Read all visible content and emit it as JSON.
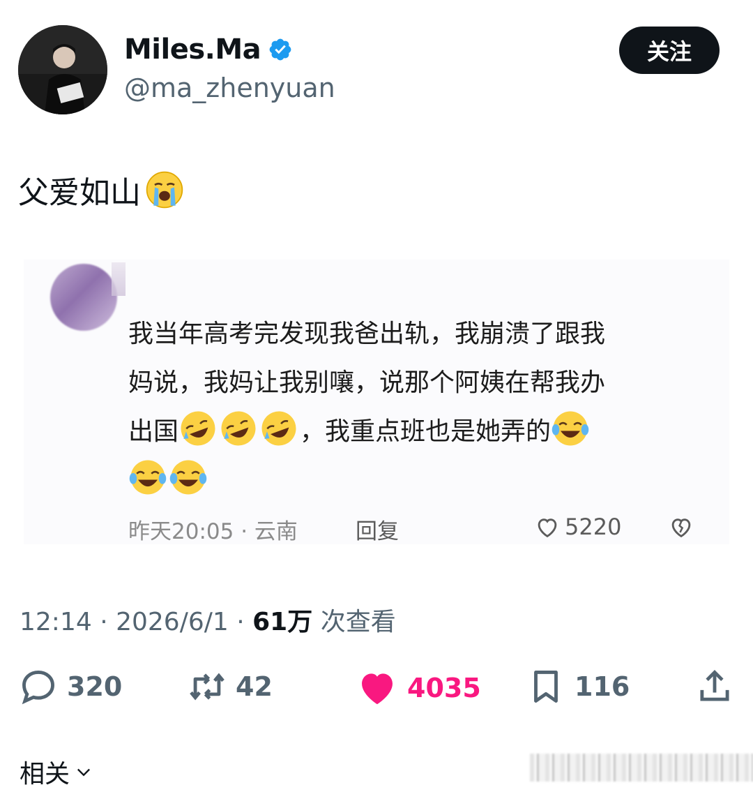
{
  "header": {
    "display_name": "Miles.Ma",
    "handle": "@ma_zhenyuan",
    "follow_label": "关注"
  },
  "tweet": {
    "text": "父爱如山",
    "emoji": "loudly-crying-face"
  },
  "embedded_comment": {
    "line1": "我当年高考完发现我爸出轨，我崩溃了跟我",
    "line2": "妈说，我妈让我别嚷，说那个阿姨在帮我办",
    "line3_prefix": "出国",
    "line3_middle": "，我重点班也是她弄的",
    "meta": "昨天20:05 · 云南",
    "reply_label": "回复",
    "likes": "5220"
  },
  "tweet_meta": {
    "time": "12:14",
    "date": "2026/6/1",
    "views": "61万",
    "views_label": "次查看"
  },
  "actions": {
    "replies": "320",
    "retweets": "42",
    "likes": "4035",
    "bookmarks": "116"
  },
  "footer": {
    "related_label": "相关"
  },
  "colors": {
    "like_active": "#f91880",
    "verified": "#1d9bf0",
    "text_secondary": "#536471"
  }
}
